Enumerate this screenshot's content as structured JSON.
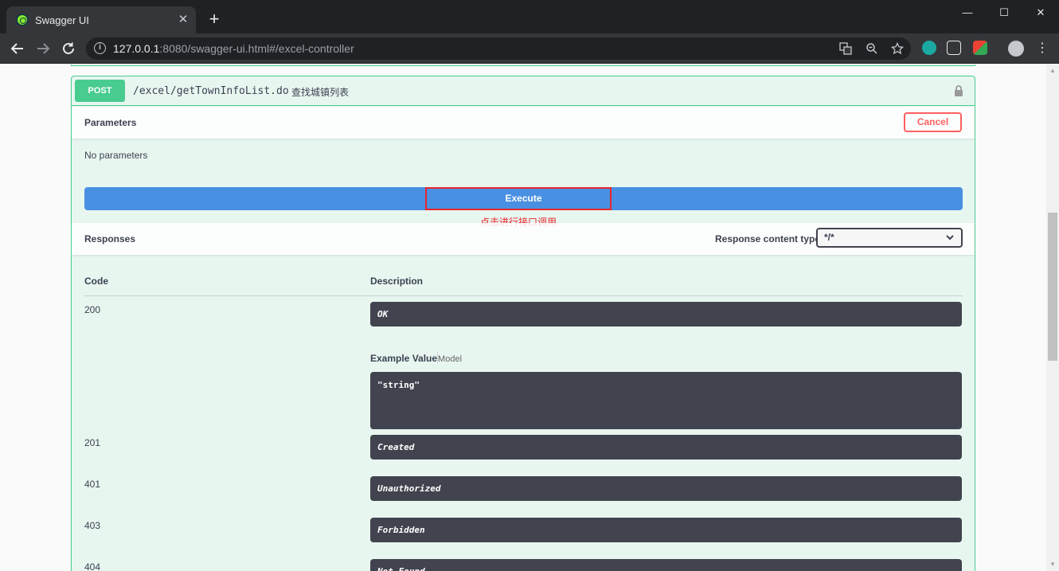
{
  "browser": {
    "tab_title": "Swagger UI",
    "tab_close": "✕",
    "new_tab": "+",
    "url_host": "127.0.0.1",
    "url_rest": ":8080/swagger-ui.html#/excel-controller",
    "window_controls": [
      "—",
      "☐",
      "✕"
    ]
  },
  "operation": {
    "method": "POST",
    "path": "/excel/getTownInfoList.do",
    "description": "查找城镇列表",
    "method_color": "#49cc90"
  },
  "parameters": {
    "title": "Parameters",
    "cancel_label": "Cancel",
    "empty_text": "No parameters"
  },
  "execute": {
    "label": "Execute",
    "annotation": "点击进行接口调用",
    "annotation_color": "#e8262a"
  },
  "responses": {
    "title": "Responses",
    "content_type_label": "Response content type",
    "content_type_value": "*/*",
    "code_header": "Code",
    "description_header": "Description",
    "example_value_label": "Example Value",
    "model_label": "Model",
    "example_body": "\"string\"",
    "rows": [
      {
        "code": "200",
        "description": "OK"
      },
      {
        "code": "201",
        "description": "Created"
      },
      {
        "code": "401",
        "description": "Unauthorized"
      },
      {
        "code": "403",
        "description": "Forbidden"
      },
      {
        "code": "404",
        "description": "Not Found"
      }
    ]
  }
}
